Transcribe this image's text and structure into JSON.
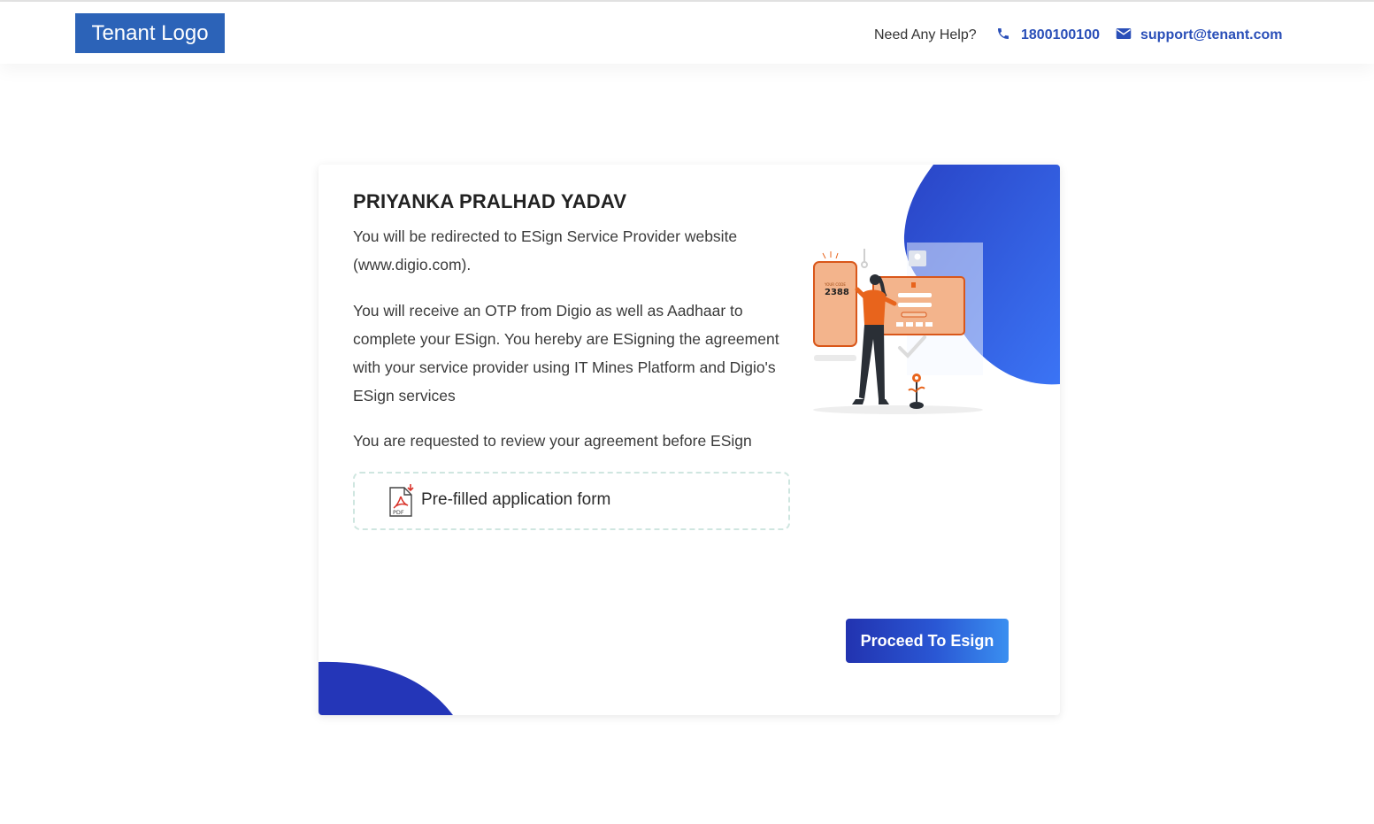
{
  "header": {
    "logo_text": "Tenant Logo",
    "help_text": "Need Any Help?",
    "phone": "1800100100",
    "email": "support@tenant.com",
    "phone_icon": "phone-icon",
    "mail_icon": "mail-icon",
    "accent_color": "#2a4fb8"
  },
  "card": {
    "user_name": "PRIYANKA PRALHAD YADAV",
    "paragraph_1": "You will be redirected to ESign Service Provider website (www.digio.com).",
    "paragraph_2": "You will receive an OTP from Digio as well as Aadhaar to complete your ESign. You hereby are ESigning the agreement with your service provider using IT Mines Platform and Digio's ESign services",
    "paragraph_3": "You are requested to review your agreement before ESign",
    "document": {
      "label": "Pre-filled application form",
      "icon": "pdf-icon"
    },
    "illustration": {
      "code_label": "YOUR CODE",
      "code": "2388"
    },
    "proceed_label": "Proceed To Esign"
  },
  "colors": {
    "brand_blue": "#2c63b8",
    "button_start": "#2233b0",
    "button_end": "#3a8ff0",
    "illustration_orange": "#e8641c"
  }
}
